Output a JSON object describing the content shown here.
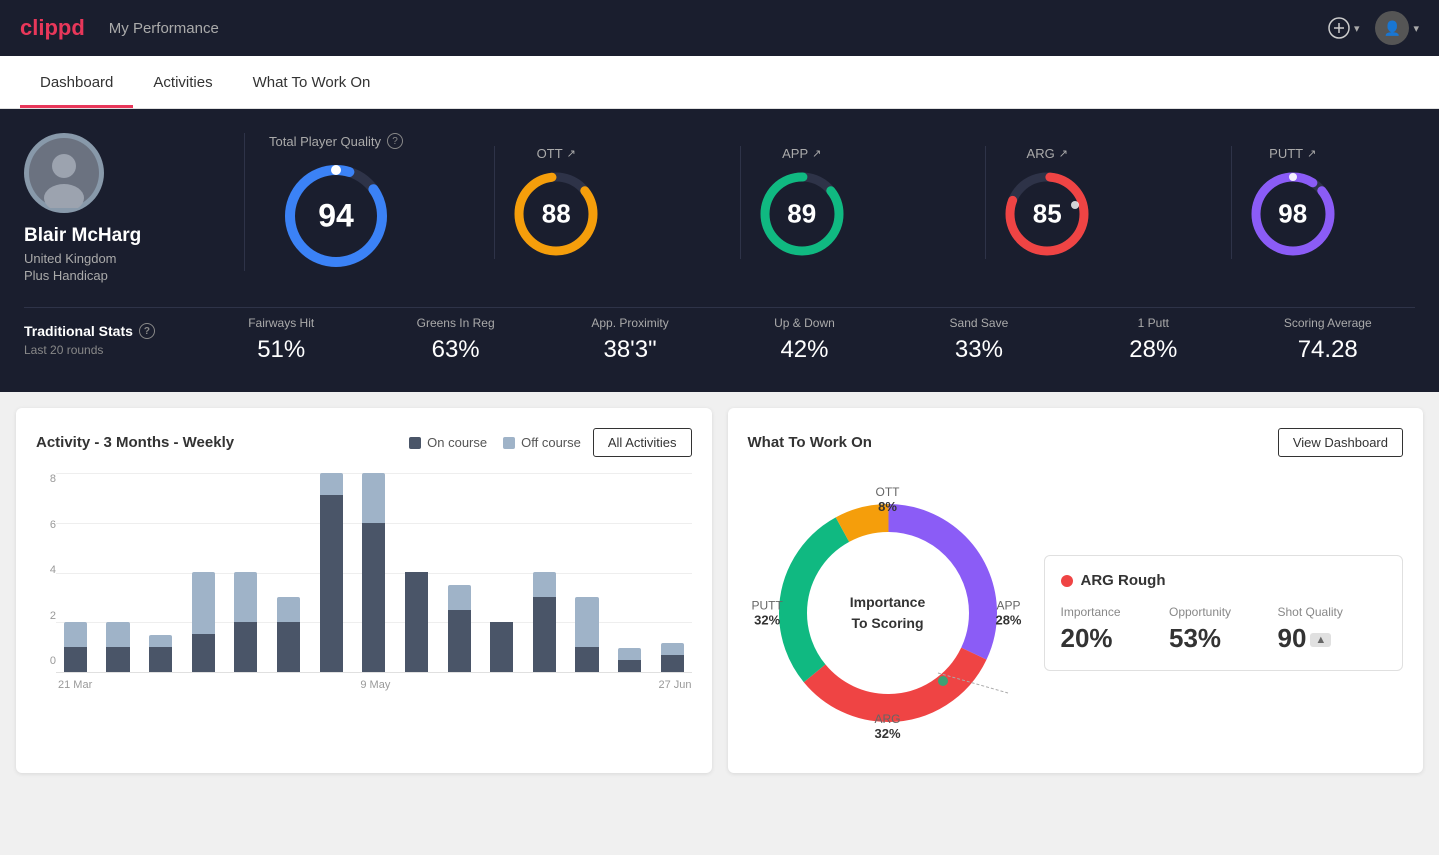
{
  "app": {
    "logo": "clippd",
    "header_title": "My Performance"
  },
  "nav": {
    "tabs": [
      {
        "label": "Dashboard",
        "active": true
      },
      {
        "label": "Activities",
        "active": false
      },
      {
        "label": "What To Work On",
        "active": false
      }
    ]
  },
  "player": {
    "name": "Blair McHarg",
    "country": "United Kingdom",
    "handicap": "Plus Handicap"
  },
  "quality": {
    "label": "Total Player Quality",
    "main": {
      "value": "94",
      "color": "#3b82f6"
    },
    "sub": [
      {
        "label": "OTT",
        "value": "88",
        "color": "#f59e0b"
      },
      {
        "label": "APP",
        "value": "89",
        "color": "#10b981"
      },
      {
        "label": "ARG",
        "value": "85",
        "color": "#ef4444"
      },
      {
        "label": "PUTT",
        "value": "98",
        "color": "#8b5cf6"
      }
    ]
  },
  "trad_stats": {
    "title": "Traditional Stats",
    "subtitle": "Last 20 rounds",
    "stats": [
      {
        "name": "Fairways Hit",
        "value": "51%"
      },
      {
        "name": "Greens In Reg",
        "value": "63%"
      },
      {
        "name": "App. Proximity",
        "value": "38'3\""
      },
      {
        "name": "Up & Down",
        "value": "42%"
      },
      {
        "name": "Sand Save",
        "value": "33%"
      },
      {
        "name": "1 Putt",
        "value": "28%"
      },
      {
        "name": "Scoring Average",
        "value": "74.28"
      }
    ]
  },
  "activity_chart": {
    "title": "Activity - 3 Months - Weekly",
    "legend": [
      {
        "label": "On course",
        "color": "#4a5568"
      },
      {
        "label": "Off course",
        "color": "#9fb3c8"
      }
    ],
    "all_activities_btn": "All Activities",
    "x_labels": [
      "21 Mar",
      "",
      "9 May",
      "",
      "27 Jun"
    ],
    "bars": [
      {
        "on": 1,
        "off": 1
      },
      {
        "on": 1,
        "off": 1
      },
      {
        "on": 1,
        "off": 0.5
      },
      {
        "on": 1.5,
        "off": 2.5
      },
      {
        "on": 2,
        "off": 2
      },
      {
        "on": 2,
        "off": 1
      },
      {
        "on": 8,
        "off": 1
      },
      {
        "on": 6,
        "off": 2
      },
      {
        "on": 4,
        "off": 0
      },
      {
        "on": 2.5,
        "off": 1
      },
      {
        "on": 2,
        "off": 0
      },
      {
        "on": 3,
        "off": 1
      },
      {
        "on": 1,
        "off": 2
      },
      {
        "on": 0.5,
        "off": 0.5
      },
      {
        "on": 0.7,
        "off": 0.5
      }
    ],
    "y_labels": [
      "0",
      "2",
      "4",
      "6",
      "8"
    ]
  },
  "what_to_work_on": {
    "title": "What To Work On",
    "view_dashboard_btn": "View Dashboard",
    "donut_center": "Importance\nTo Scoring",
    "segments": [
      {
        "label": "OTT",
        "pct": "8%",
        "color": "#f59e0b"
      },
      {
        "label": "APP",
        "pct": "28%",
        "color": "#10b981"
      },
      {
        "label": "ARG",
        "pct": "32%",
        "color": "#ef4444"
      },
      {
        "label": "PUTT",
        "pct": "32%",
        "color": "#8b5cf6"
      }
    ],
    "info_card": {
      "title": "ARG Rough",
      "dot_color": "#ef4444",
      "metrics": [
        {
          "name": "Importance",
          "value": "20%"
        },
        {
          "name": "Opportunity",
          "value": "53%"
        },
        {
          "name": "Shot Quality",
          "value": "90",
          "badge": "▲"
        }
      ]
    }
  }
}
